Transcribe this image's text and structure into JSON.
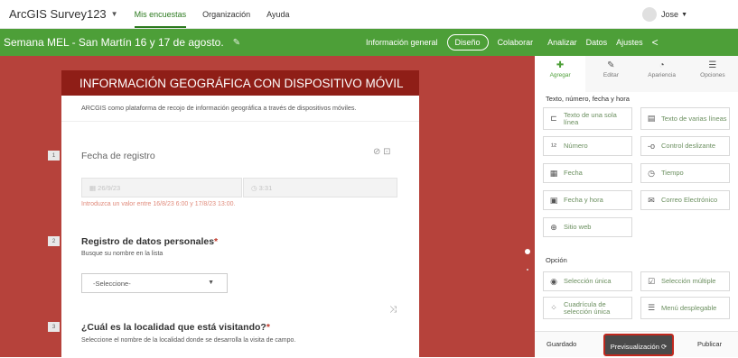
{
  "topnav": {
    "app_title": "ArcGIS Survey123",
    "items": [
      {
        "label": "Mis encuestas"
      },
      {
        "label": "Organización"
      },
      {
        "label": "Ayuda"
      }
    ],
    "user": "Jose"
  },
  "greenbar": {
    "survey_title": "Semana MEL - San Martín 16 y 17 de agosto.",
    "tabs": [
      {
        "label": "Información general"
      },
      {
        "label": "Diseño"
      },
      {
        "label": "Colaborar"
      },
      {
        "label": "Analizar"
      },
      {
        "label": "Datos"
      },
      {
        "label": "Ajustes"
      }
    ]
  },
  "form": {
    "header": "INFORMACIÓN GEOGRÁFICA CON DISPOSITIVO MÓVIL",
    "description": "ARCGIS como plataforma de recojo de información geográfica a través de dispositivos móviles.",
    "questions": [
      {
        "number": "1",
        "label": "Fecha de registro",
        "date_value": "26/9/23",
        "time_value": "3:31",
        "error": "Introduzca un valor entre 16/8/23 6:00 y 17/8/23 13:00."
      },
      {
        "number": "2",
        "label": "Registro de datos personales",
        "required_mark": "*",
        "hint": "Busque su nombre en la lista",
        "select_value": "-Seleccione-"
      },
      {
        "number": "3",
        "label": "¿Cuál es la localidad que está visitando?",
        "required_mark": "*",
        "hint": "Seleccione el nombre de la localidad donde se desarrolla la visita de campo."
      }
    ]
  },
  "panel": {
    "tabs": [
      {
        "label": "Agregar",
        "icon": "plus-icon"
      },
      {
        "label": "Editar",
        "icon": "pencil-icon"
      },
      {
        "label": "Apariencia",
        "icon": "palette-icon"
      },
      {
        "label": "Opciones",
        "icon": "sliders-icon"
      }
    ],
    "section1": "Texto, número, fecha y hora",
    "types1": [
      {
        "label": "Texto de una sola línea",
        "icon": "single-line-text-icon"
      },
      {
        "label": "Texto de varias líneas",
        "icon": "multiline-text-icon"
      },
      {
        "label": "Número",
        "icon": "number-icon"
      },
      {
        "label": "Control deslizante",
        "icon": "slider-icon"
      },
      {
        "label": "Fecha",
        "icon": "calendar-icon"
      },
      {
        "label": "Tiempo",
        "icon": "clock-icon"
      },
      {
        "label": "Fecha y hora",
        "icon": "datetime-icon"
      },
      {
        "label": "Correo Electrónico",
        "icon": "email-icon"
      },
      {
        "label": "Sitio web",
        "icon": "globe-icon"
      }
    ],
    "section2": "Opción",
    "types2": [
      {
        "label": "Selección única",
        "icon": "radio-icon"
      },
      {
        "label": "Selección múltiple",
        "icon": "checkbox-icon"
      },
      {
        "label": "Cuadrícula de selección única",
        "icon": "grid-icon"
      },
      {
        "label": "Menú desplegable",
        "icon": "dropdown-icon"
      }
    ],
    "footer": {
      "saved": "Guardado",
      "preview": "Previsualización",
      "publish": "Publicar"
    }
  },
  "colors": {
    "green": "#4d9f38",
    "canvas_red": "#b6423b",
    "header_dark_red": "#8f1e17",
    "preview_border": "#c0281e"
  }
}
